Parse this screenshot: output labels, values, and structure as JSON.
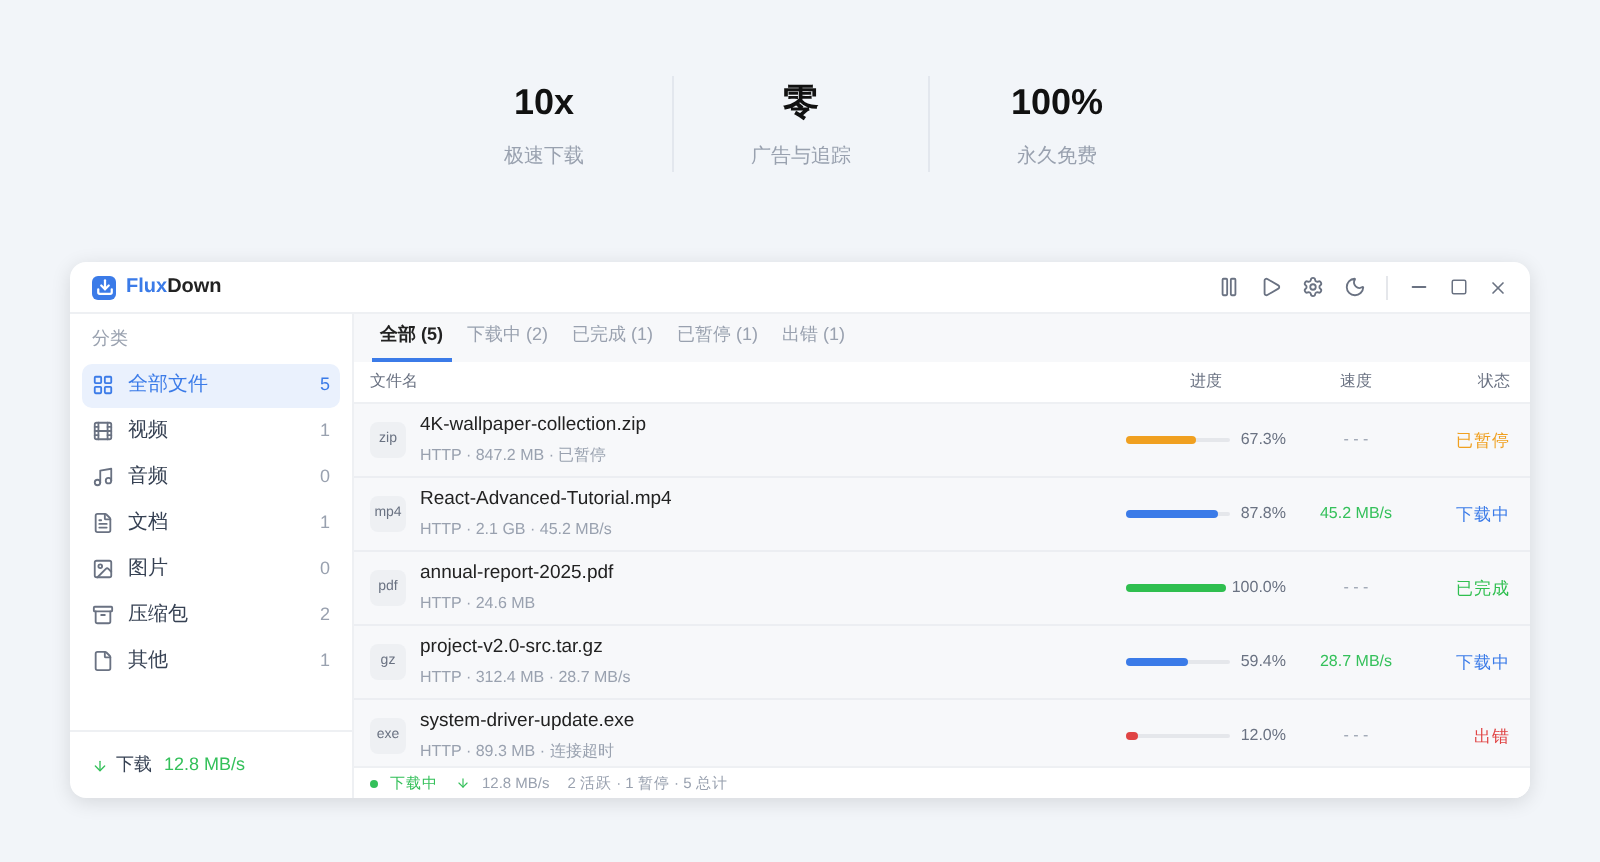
{
  "stats": [
    {
      "value": "10x",
      "label": "极速下载"
    },
    {
      "value": "零",
      "label": "广告与追踪"
    },
    {
      "value": "100%",
      "label": "永久免费"
    }
  ],
  "window": {
    "title_prefix": "Flux",
    "title_suffix": "Down"
  },
  "sidebar": {
    "heading": "分类",
    "items": [
      {
        "kind": "grid",
        "label": "全部文件",
        "count": "5",
        "selected": true
      },
      {
        "kind": "film",
        "label": "视频",
        "count": "1",
        "selected": false
      },
      {
        "kind": "music",
        "label": "音频",
        "count": "0",
        "selected": false
      },
      {
        "kind": "doc",
        "label": "文档",
        "count": "1",
        "selected": false
      },
      {
        "kind": "image",
        "label": "图片",
        "count": "0",
        "selected": false
      },
      {
        "kind": "archive",
        "label": "压缩包",
        "count": "2",
        "selected": false
      },
      {
        "kind": "file",
        "label": "其他",
        "count": "1",
        "selected": false
      }
    ],
    "footer": {
      "label": "下载",
      "speed": "12.8 MB/s"
    }
  },
  "tabs": [
    {
      "label": "全部 (5)",
      "selected": true
    },
    {
      "label": "下载中 (2)",
      "selected": false
    },
    {
      "label": "已完成 (1)",
      "selected": false
    },
    {
      "label": "已暂停 (1)",
      "selected": false
    },
    {
      "label": "出错 (1)",
      "selected": false
    }
  ],
  "table": {
    "columns": [
      "文件名",
      "进度",
      "速度",
      "状态"
    ],
    "rows": [
      {
        "type": "zip",
        "name": "4K-wallpaper-collection.zip",
        "meta": "HTTP · 847.2 MB · 已暂停",
        "level": 0.673,
        "percent": "67.3%",
        "speed": "- - -",
        "status": "已暂停",
        "kind": "paused"
      },
      {
        "type": "mp4",
        "name": "React-Advanced-Tutorial.mp4",
        "meta": "HTTP · 2.1 GB · 45.2 MB/s",
        "level": 0.878,
        "percent": "87.8%",
        "speed": "45.2 MB/s",
        "status": "下载中",
        "kind": "downloading"
      },
      {
        "type": "pdf",
        "name": "annual-report-2025.pdf",
        "meta": "HTTP · 24.6 MB",
        "level": 1.0,
        "percent": "100.0%",
        "speed": "- - -",
        "status": "已完成",
        "kind": "done"
      },
      {
        "type": "gz",
        "name": "project-v2.0-src.tar.gz",
        "meta": "HTTP · 312.4 MB · 28.7 MB/s",
        "level": 0.594,
        "percent": "59.4%",
        "speed": "28.7 MB/s",
        "status": "下载中",
        "kind": "downloading"
      },
      {
        "type": "exe",
        "name": "system-driver-update.exe",
        "meta": "HTTP · 89.3 MB · 连接超时",
        "level": 0.12,
        "percent": "12.0%",
        "speed": "- - -",
        "status": "出错",
        "kind": "error"
      }
    ]
  },
  "status_bar": {
    "state": "下载中",
    "speed": "12.8 MB/s",
    "summary": "2 活跃 · 1 暂停 · 5 总计"
  }
}
